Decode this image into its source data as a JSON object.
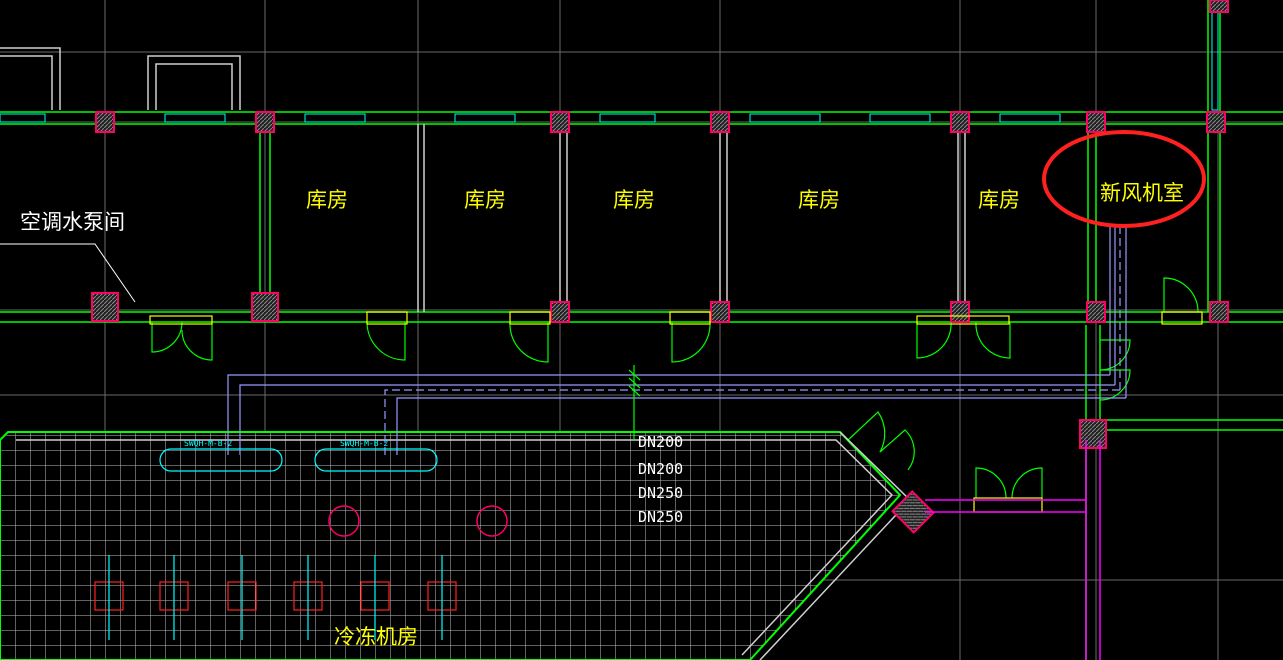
{
  "drawing": {
    "rooms": [
      {
        "name": "空调水泵间",
        "color": "white"
      },
      {
        "name": "库房",
        "color": "yellow"
      },
      {
        "name": "库房",
        "color": "yellow"
      },
      {
        "name": "库房",
        "color": "yellow"
      },
      {
        "name": "库房",
        "color": "yellow"
      },
      {
        "name": "库房",
        "color": "yellow"
      },
      {
        "name": "新风机室",
        "color": "yellow"
      },
      {
        "name": "冷冻机房",
        "color": "yellow"
      }
    ],
    "pipe_sizes": [
      "DN200",
      "DN200",
      "DN250",
      "DN250"
    ],
    "equipment_tags": [
      "SWQH-M-B-2",
      "SWQH-M-B-2"
    ],
    "highlight": {
      "target": "新风机室",
      "color": "#ff2020"
    },
    "colors": {
      "background": "#000000",
      "wall": "#00ff00",
      "column": "#ff0066",
      "door": "#ffff00",
      "grid": "#808080",
      "pipe": "#9999ff",
      "equipment": "#00ffff",
      "highlight": "#ff2020"
    }
  }
}
